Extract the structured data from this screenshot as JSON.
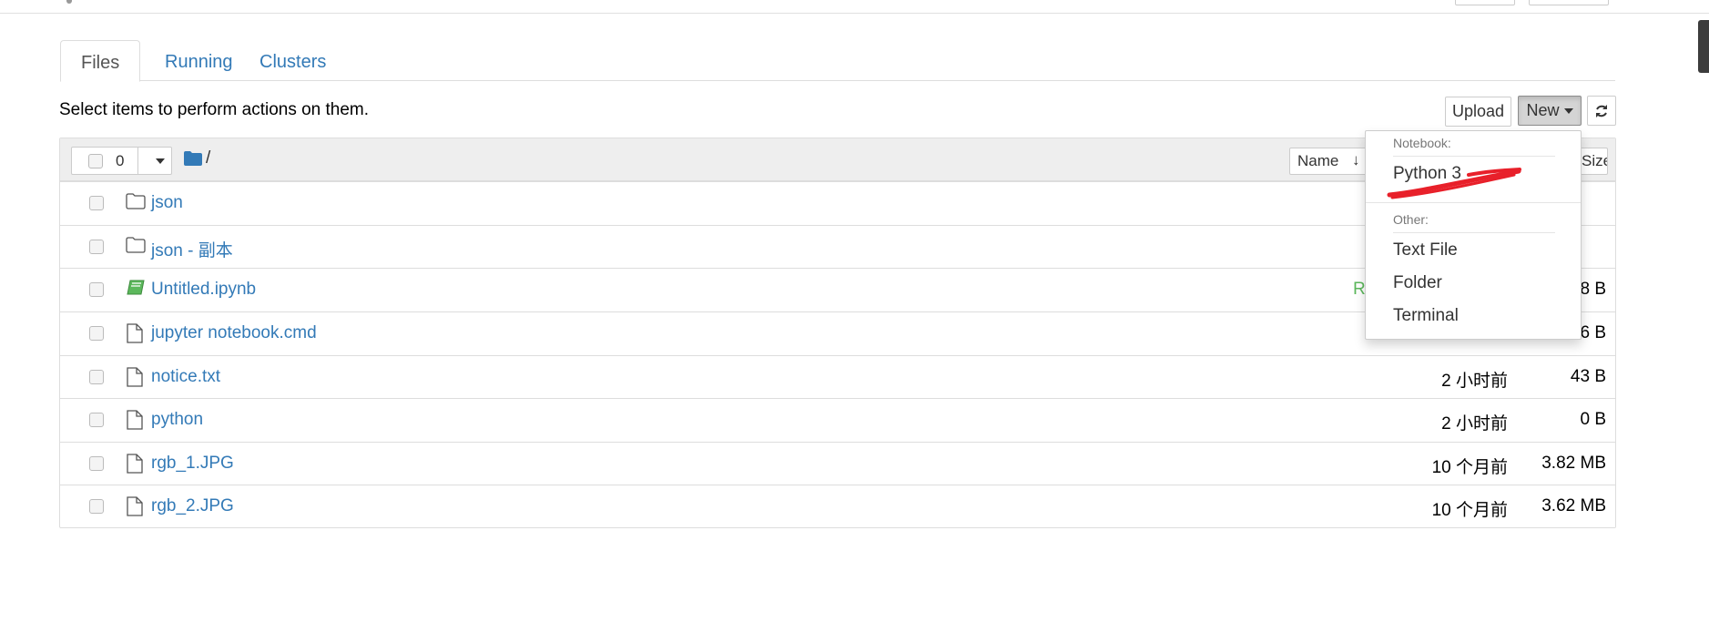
{
  "tabs": [
    {
      "label": "Files"
    },
    {
      "label": "Running"
    },
    {
      "label": "Clusters"
    }
  ],
  "toolbar": {
    "hint": "Select items to perform actions on them.",
    "upload_label": "Upload",
    "new_label": "New"
  },
  "list_header": {
    "selected_count": "0",
    "path": "/",
    "name_sort_label": "Name",
    "size_sort_label": "Size"
  },
  "files": [
    {
      "name": "json",
      "type": "folder",
      "modified": "",
      "size": ""
    },
    {
      "name": "json - 副本",
      "type": "folder",
      "modified": "",
      "size": ""
    },
    {
      "name": "Untitled.ipynb",
      "type": "notebook",
      "status": "R",
      "modified": "",
      "size": "8 B"
    },
    {
      "name": "jupyter notebook.cmd",
      "type": "file",
      "modified": "",
      "size": "6 B"
    },
    {
      "name": "notice.txt",
      "type": "file",
      "modified": "2 小时前",
      "size": "43 B"
    },
    {
      "name": "python",
      "type": "file",
      "modified": "2 小时前",
      "size": "0 B"
    },
    {
      "name": "rgb_1.JPG",
      "type": "file",
      "modified": "10 个月前",
      "size": "3.82 MB"
    },
    {
      "name": "rgb_2.JPG",
      "type": "file",
      "modified": "10 个月前",
      "size": "3.62 MB"
    }
  ],
  "new_menu": {
    "notebook_header": "Notebook:",
    "python3": "Python 3",
    "other_header": "Other:",
    "text_file": "Text File",
    "folder": "Folder",
    "terminal": "Terminal"
  },
  "colors": {
    "link": "#337ab7",
    "running": "#5cb85c",
    "notebook_icon": "#5cb85c",
    "folder_icon": "#337ab7",
    "annotation": "#e8202a"
  }
}
